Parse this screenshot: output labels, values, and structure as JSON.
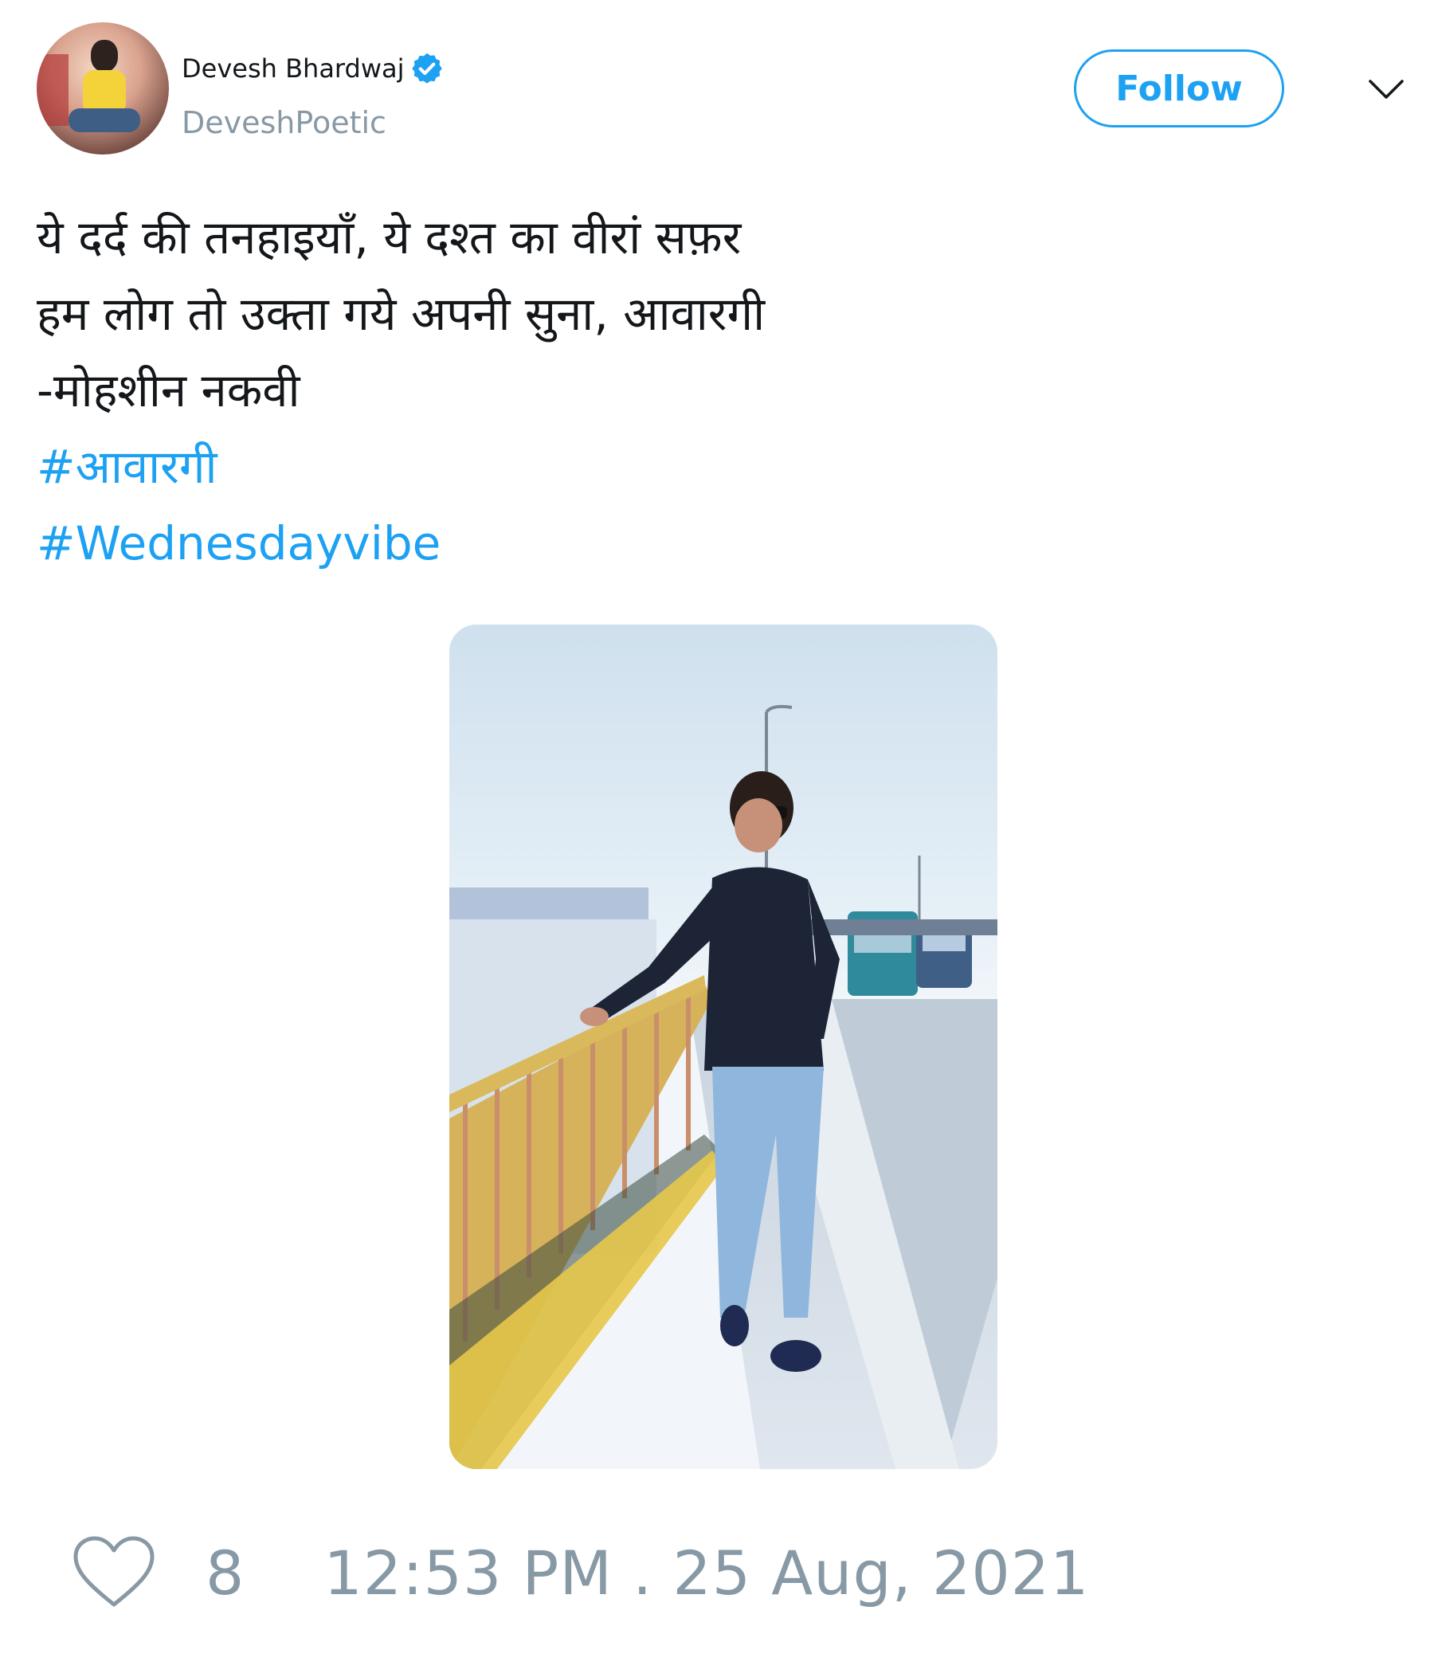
{
  "author": {
    "display_name": "Devesh Bhardwaj",
    "handle": "DeveshPoetic",
    "verified": true,
    "verified_icon": "verified-badge-icon"
  },
  "follow_button": {
    "label": "Follow"
  },
  "menu": {
    "icon": "chevron-down-icon"
  },
  "tweet": {
    "lines": [
      "ये दर्द की तनहाइयाँ, ये दश्त का वीरां सफ़र",
      "हम लोग तो उक्ता गये अपनी सुना, आवारगी",
      "-मोहशीन नकवी"
    ],
    "hashtags": [
      "#आवारगी",
      "#Wednesdayvibe"
    ]
  },
  "footer": {
    "like_icon": "heart-icon",
    "like_count": "8",
    "timestamp": "12:53 PM . 25 Aug, 2021"
  },
  "colors": {
    "accent": "#1da1f2",
    "text": "#14171a",
    "muted": "#8899a6"
  }
}
